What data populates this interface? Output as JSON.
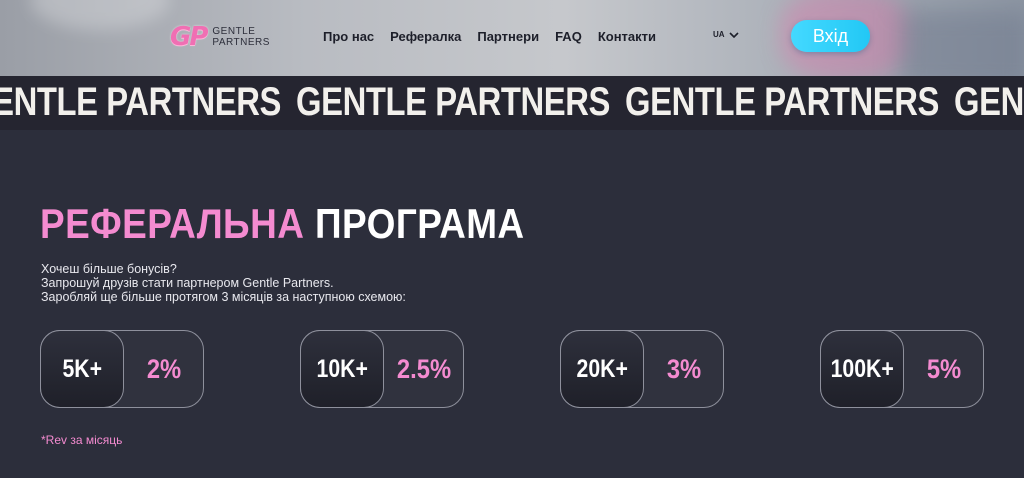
{
  "header": {
    "logo_mark": "GP",
    "logo_line1": "GENTLE",
    "logo_line2": "PARTNERS",
    "nav": [
      "Про нас",
      "Рефералка",
      "Партнери",
      "FAQ",
      "Контакти"
    ],
    "lang": "UA",
    "login_label": "Вхід"
  },
  "marquee": {
    "text": "GENTLE PARTNERS"
  },
  "referral": {
    "title_pink": "РЕФЕРАЛЬНА",
    "title_white": "ПРОГРАМА",
    "lines": [
      "Хочеш більше бонусів?",
      "Запрошуй друзів стати партнером Gentle Partners.",
      "Заробляй ще більше протягом 3 місяців за наступною схемою:"
    ],
    "tiers": [
      {
        "amount": "5K+",
        "percent": "2%"
      },
      {
        "amount": "10K+",
        "percent": "2.5%"
      },
      {
        "amount": "20K+",
        "percent": "3%"
      },
      {
        "amount": "100K+",
        "percent": "5%"
      }
    ],
    "note": "*Rev за місяць"
  },
  "colors": {
    "accent_pink": "#f48bd0",
    "button_cyan": "#22c8f5",
    "background": "#2c2e3b"
  }
}
